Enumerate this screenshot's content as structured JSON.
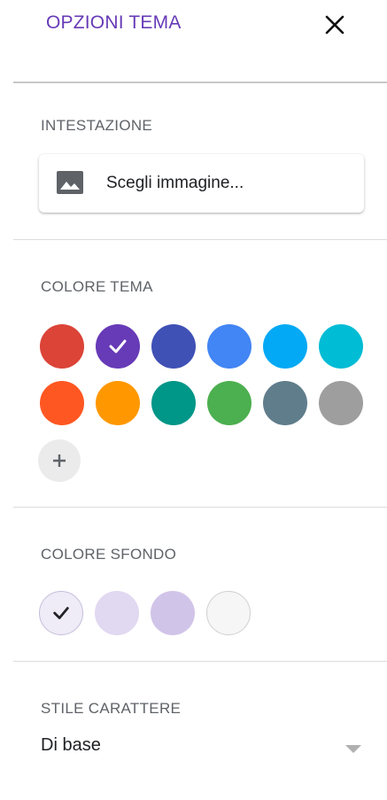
{
  "panel": {
    "title": "OPZIONI TEMA",
    "close_icon": "close-icon"
  },
  "header_section": {
    "label": "INTESTAZIONE",
    "image_button_label": "Scegli immagine...",
    "image_icon": "image-icon"
  },
  "theme_color_section": {
    "label": "COLORE TEMA",
    "selected_index": 1,
    "colors": [
      "#db4437",
      "#673ab7",
      "#3f51b5",
      "#4285f4",
      "#03a9f4",
      "#00bcd4",
      "#ff5722",
      "#ff9800",
      "#009688",
      "#4caf50",
      "#607d8b",
      "#9e9e9e"
    ],
    "add_icon": "plus-icon"
  },
  "background_section": {
    "label": "COLORE SFONDO",
    "selected_index": 0,
    "colors": [
      "#efebf7",
      "#e1d8f1",
      "#d1c4e9",
      "#f6f6f6"
    ]
  },
  "font_section": {
    "label": "STILE CARATTERE",
    "selected_value": "Di base"
  }
}
